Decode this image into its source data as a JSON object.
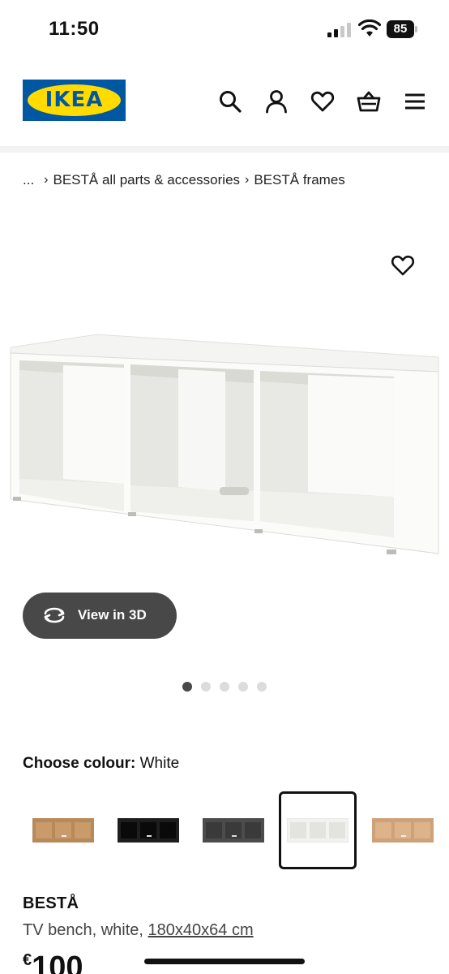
{
  "status_bar": {
    "time": "11:50",
    "battery": "85"
  },
  "header": {
    "logo_text": "IKEA"
  },
  "breadcrumb": {
    "ellipsis": "...",
    "items": [
      "BESTÅ all parts & accessories",
      "BESTÅ frames"
    ],
    "separator": "›"
  },
  "gallery": {
    "view3d_label": "View in 3D",
    "dots_total": 5,
    "active_dot": 0
  },
  "colour": {
    "label": "Choose colour:",
    "selected": "White",
    "swatches": [
      {
        "name": "white-stained-oak",
        "color": "#b78a5a"
      },
      {
        "name": "black-brown",
        "color": "#1e1e1e"
      },
      {
        "name": "dark-grey",
        "color": "#4c4c4c"
      },
      {
        "name": "white",
        "color": "#f2f2f2"
      },
      {
        "name": "oak-effect",
        "color": "#cfa178"
      }
    ],
    "selected_index": 3
  },
  "product": {
    "name": "BESTÅ",
    "desc_prefix": "TV bench, white, ",
    "dimensions": "180x40x64 cm",
    "currency": "€",
    "price": "100"
  }
}
